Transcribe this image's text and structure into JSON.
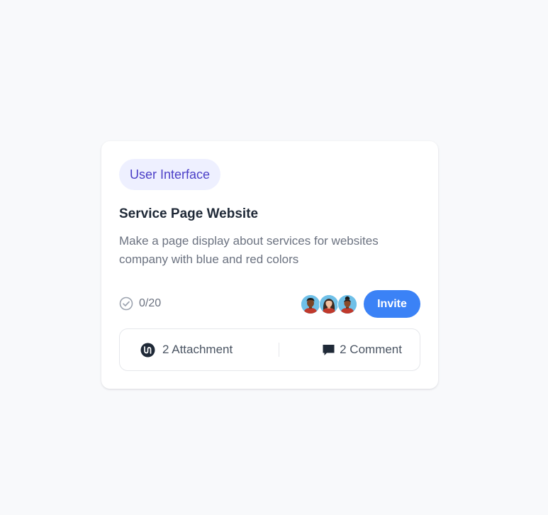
{
  "card": {
    "tag": "User Interface",
    "title": "Service Page Website",
    "description": "Make a page display about services for websites company with blue and red colors",
    "progress": {
      "icon": "check-circle-icon",
      "text": "0/20"
    },
    "avatars": [
      {
        "icon": "avatar-man-icon"
      },
      {
        "icon": "avatar-woman-icon"
      },
      {
        "icon": "avatar-woman-2-icon"
      }
    ],
    "invite_label": "Invite",
    "footer": {
      "attachment": {
        "icon": "attachment-icon",
        "label": "2 Attachment"
      },
      "comment": {
        "icon": "comment-icon",
        "label": "2 Comment"
      }
    }
  },
  "colors": {
    "background": "#f8f9fb",
    "card": "#ffffff",
    "tag_bg": "#eef0ff",
    "tag_text": "#4b3fc7",
    "accent": "#3b82f6",
    "title": "#1f2937",
    "muted": "#6b7280"
  }
}
